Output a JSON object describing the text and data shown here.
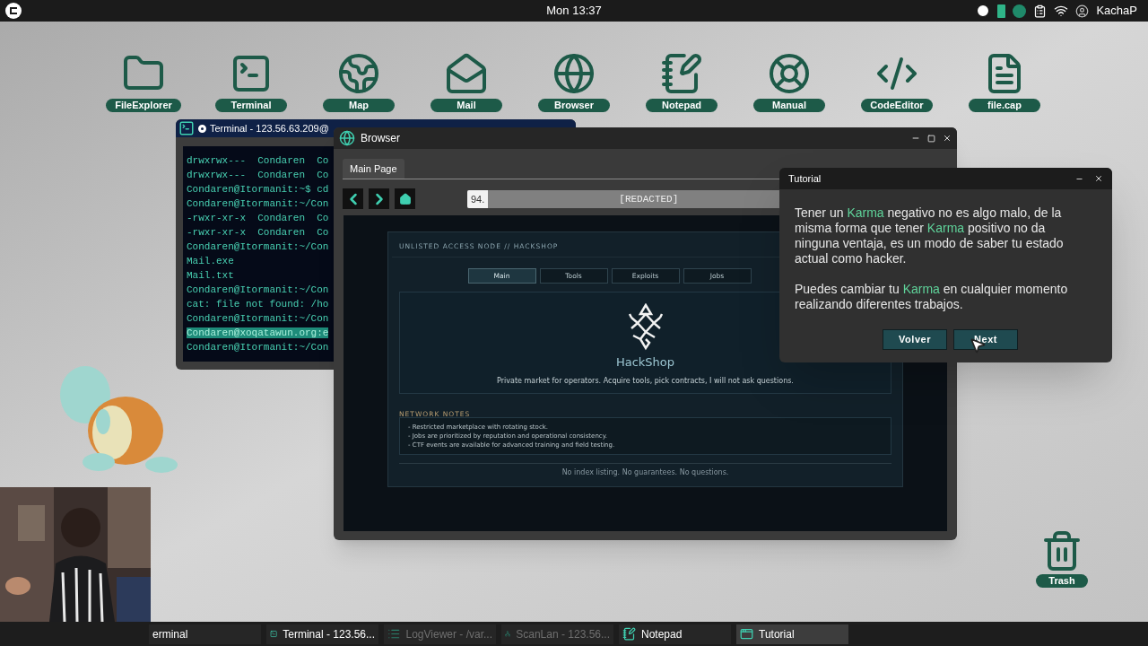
{
  "top_bar": {
    "clock": "Mon 13:37",
    "user": "KachaP"
  },
  "desktop_icons": [
    {
      "label": "FileExplorer",
      "kind": "folder"
    },
    {
      "label": "Terminal",
      "kind": "terminal"
    },
    {
      "label": "Map",
      "kind": "map"
    },
    {
      "label": "Mail",
      "kind": "mail"
    },
    {
      "label": "Browser",
      "kind": "browser"
    },
    {
      "label": "Notepad",
      "kind": "notepad"
    },
    {
      "label": "Manual",
      "kind": "manual"
    },
    {
      "label": "CodeEditor",
      "kind": "code"
    },
    {
      "label": "file.cap",
      "kind": "file"
    }
  ],
  "trash": {
    "label": "Trash"
  },
  "terminal": {
    "title": "Terminal - 123.56.63.209@",
    "lines": [
      {
        "text": "drwxrwx---  Condaren  Co",
        "selected": false
      },
      {
        "text": "drwxrwx---  Condaren  Co",
        "selected": false
      },
      {
        "text": "Condaren@Itormanit:~$ cd",
        "selected": false
      },
      {
        "text": "Condaren@Itormanit:~/Con",
        "selected": false
      },
      {
        "text": "-rwxr-xr-x  Condaren  Co",
        "selected": false
      },
      {
        "text": "-rwxr-xr-x  Condaren  Co",
        "selected": false
      },
      {
        "text": "Condaren@Itormanit:~/Con",
        "selected": false
      },
      {
        "text": "Mail.exe",
        "selected": false
      },
      {
        "text": "Mail.txt",
        "selected": false
      },
      {
        "text": "Condaren@Itormanit:~/Con",
        "selected": false
      },
      {
        "text": "cat: file not found: /ho",
        "selected": false
      },
      {
        "text": "Condaren@Itormanit:~/Con",
        "selected": false
      },
      {
        "text": "Condaren@xoqatawun.org:e",
        "selected": true
      },
      {
        "text": "Condaren@Itormanit:~/Con",
        "selected": false
      }
    ]
  },
  "browser": {
    "title": "Browser",
    "tab": "Main Page",
    "address_prefix": "94.",
    "address": "[REDACTED]",
    "page": {
      "header": "UNLISTED ACCESS NODE // HACKSHOP",
      "tabs": [
        {
          "label": "Main",
          "selected": true
        },
        {
          "label": "Tools",
          "selected": false
        },
        {
          "label": "Exploits",
          "selected": false
        },
        {
          "label": "Jobs",
          "selected": false
        }
      ],
      "brand": "HackShop",
      "tagline": "Private market for operators. Acquire tools, pick contracts, I will not ask questions.",
      "notes_title": "NETWORK NOTES",
      "notes": [
        "- Restricted marketplace with rotating stock.",
        "- Jobs are prioritized by reputation and operational consistency.",
        "- CTF events are available for advanced training and field testing."
      ],
      "footer": "No index listing. No guarantees. No questions."
    }
  },
  "tutorial": {
    "title": "Tutorial",
    "paragraphs": [
      [
        {
          "text": "Tener un ",
          "highlight": false
        },
        {
          "text": "Karma",
          "highlight": true
        },
        {
          "text": " negativo no es algo malo, de la misma forma que tener ",
          "highlight": false
        },
        {
          "text": "Karma",
          "highlight": true
        },
        {
          "text": " positivo no da ninguna ventaja, es un modo de saber tu estado actual como hacker.",
          "highlight": false
        }
      ],
      [
        {
          "text": "Puedes cambiar tu ",
          "highlight": false
        },
        {
          "text": "Karma",
          "highlight": true
        },
        {
          "text": " en cualquier momento realizando diferentes trabajos.",
          "highlight": false
        }
      ]
    ],
    "buttons": [
      "Volver",
      "Next"
    ]
  },
  "taskbar": [
    {
      "label": "erminal",
      "selected": false,
      "minimized": false
    },
    {
      "label": "Terminal - 123.56...",
      "selected": false,
      "minimized": false
    },
    {
      "label": "LogViewer - /var...",
      "selected": false,
      "minimized": true
    },
    {
      "label": "ScanLan - 123.56...",
      "selected": false,
      "minimized": true
    },
    {
      "label": "Notepad",
      "selected": false,
      "minimized": false
    },
    {
      "label": "Tutorial",
      "selected": true,
      "minimized": false
    }
  ]
}
